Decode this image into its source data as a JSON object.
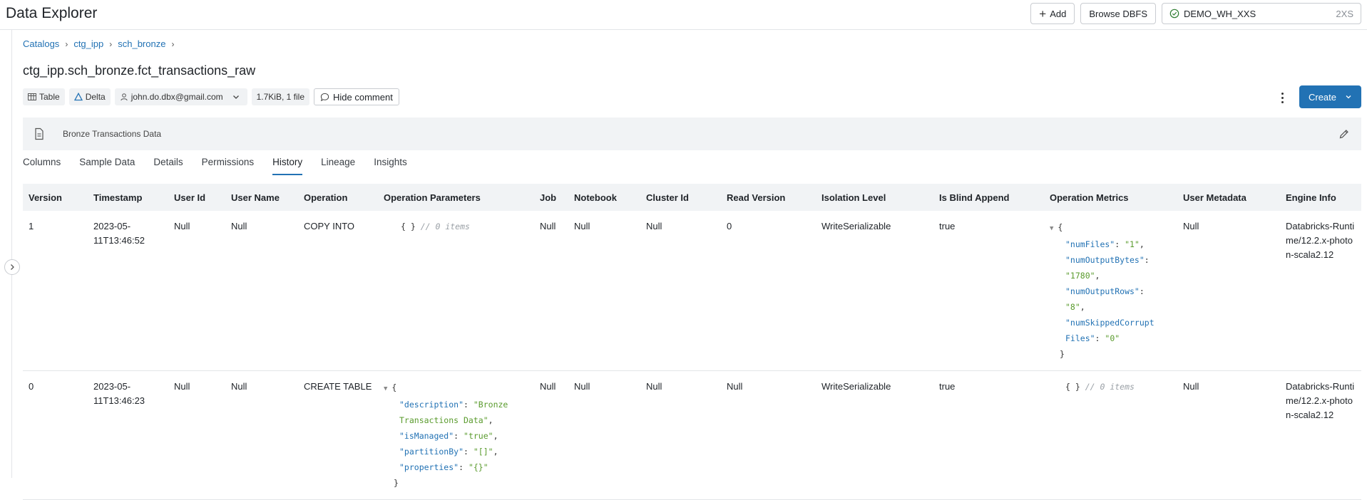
{
  "app": {
    "title": "Data Explorer"
  },
  "top_actions": {
    "add_label": "Add",
    "browse_label": "Browse DBFS",
    "warehouse_name": "DEMO_WH_XXS",
    "warehouse_size": "2XS"
  },
  "breadcrumb": [
    "Catalogs",
    "ctg_ipp",
    "sch_bronze"
  ],
  "table": {
    "full_name": "ctg_ipp.sch_bronze.fct_transactions_raw",
    "type": "Table",
    "format": "Delta",
    "owner": "john.do.dbx@gmail.com",
    "size": "1.7KiB, 1 file",
    "hide_comment_label": "Hide comment",
    "create_label": "Create",
    "comment": "Bronze Transactions Data"
  },
  "tabs": [
    "Columns",
    "Sample Data",
    "Details",
    "Permissions",
    "History",
    "Lineage",
    "Insights"
  ],
  "active_tab": "History",
  "history": {
    "columns": [
      "Version",
      "Timestamp",
      "User Id",
      "User Name",
      "Operation",
      "Operation Parameters",
      "Job",
      "Notebook",
      "Cluster Id",
      "Read Version",
      "Isolation Level",
      "Is Blind Append",
      "Operation Metrics",
      "User Metadata",
      "Engine Info"
    ],
    "empty_json": "{ }",
    "empty_items": "// 0 items",
    "rows": [
      {
        "version": "1",
        "timestamp": "2023-05-11T13:46:52",
        "user_id": "Null",
        "user_name": "Null",
        "operation": "COPY INTO",
        "job": "Null",
        "notebook": "Null",
        "cluster_id": "Null",
        "read_version": "0",
        "isolation_level": "WriteSerializable",
        "is_blind_append": "true",
        "metrics": [
          {
            "key": "\"numFiles\"",
            "value": "\"1\""
          },
          {
            "key": "\"numOutputBytes\"",
            "value": "\"1780\""
          },
          {
            "key": "\"numOutputRows\"",
            "value": "\"8\""
          },
          {
            "key": "\"numSkippedCorruptFiles\"",
            "value": "\"0\""
          }
        ],
        "user_metadata": "Null",
        "engine_info": "Databricks-Runtime/12.2.x-photon-scala2.12"
      },
      {
        "version": "0",
        "timestamp": "2023-05-11T13:46:23",
        "user_id": "Null",
        "user_name": "Null",
        "operation": "CREATE TABLE",
        "params": [
          {
            "key": "\"description\"",
            "value": "\"Bronze Transactions Data\""
          },
          {
            "key": "\"isManaged\"",
            "value": "\"true\""
          },
          {
            "key": "\"partitionBy\"",
            "value": "\"[]\""
          },
          {
            "key": "\"properties\"",
            "value": "\"{}\""
          }
        ],
        "job": "Null",
        "notebook": "Null",
        "cluster_id": "Null",
        "read_version": "Null",
        "isolation_level": "WriteSerializable",
        "is_blind_append": "true",
        "user_metadata": "Null",
        "engine_info": "Databricks-Runtime/12.2.x-photon-scala2.12"
      }
    ]
  },
  "colors": {
    "accent": "#2272b4",
    "json_key": "#2272b4",
    "json_string": "#5a9b2d"
  }
}
